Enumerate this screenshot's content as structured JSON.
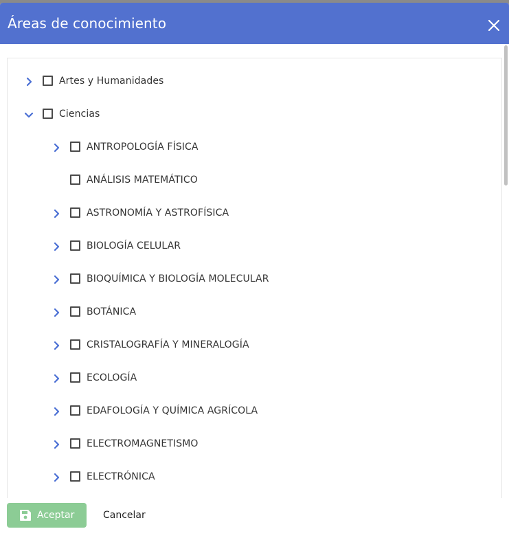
{
  "dialog": {
    "title": "Áreas de conocimiento",
    "close_icon": "close-icon"
  },
  "tree": {
    "items": [
      {
        "label": "Artes y Humanidades",
        "level": 0,
        "chevron": "right",
        "checked": false
      },
      {
        "label": "Ciencias",
        "level": 0,
        "chevron": "down",
        "checked": false
      },
      {
        "label": "ANTROPOLOGÍA FÍSICA",
        "level": 1,
        "chevron": "right",
        "checked": false
      },
      {
        "label": "ANÁLISIS MATEMÁTICO",
        "level": 1,
        "chevron": "none",
        "checked": false
      },
      {
        "label": "ASTRONOMÍA Y ASTROFÍSICA",
        "level": 1,
        "chevron": "right",
        "checked": false
      },
      {
        "label": "BIOLOGÍA CELULAR",
        "level": 1,
        "chevron": "right",
        "checked": false
      },
      {
        "label": "BIOQUÍMICA Y BIOLOGÍA MOLECULAR",
        "level": 1,
        "chevron": "right",
        "checked": false
      },
      {
        "label": "BOTÁNICA",
        "level": 1,
        "chevron": "right",
        "checked": false
      },
      {
        "label": "CRISTALOGRAFÍA Y MINERALOGÍA",
        "level": 1,
        "chevron": "right",
        "checked": false
      },
      {
        "label": "ECOLOGÍA",
        "level": 1,
        "chevron": "right",
        "checked": false
      },
      {
        "label": "EDAFOLOGÍA Y QUÍMICA AGRÍCOLA",
        "level": 1,
        "chevron": "right",
        "checked": false
      },
      {
        "label": "ELECTROMAGNETISMO",
        "level": 1,
        "chevron": "right",
        "checked": false
      },
      {
        "label": "ELECTRÓNICA",
        "level": 1,
        "chevron": "right",
        "checked": false
      }
    ]
  },
  "footer": {
    "accept_label": "Aceptar",
    "accept_icon": "save-icon",
    "accept_enabled": false,
    "cancel_label": "Cancelar"
  },
  "colors": {
    "header_bg": "#5271cf",
    "chevron": "#4a6fd4",
    "accept_bg": "#8ccc95"
  }
}
